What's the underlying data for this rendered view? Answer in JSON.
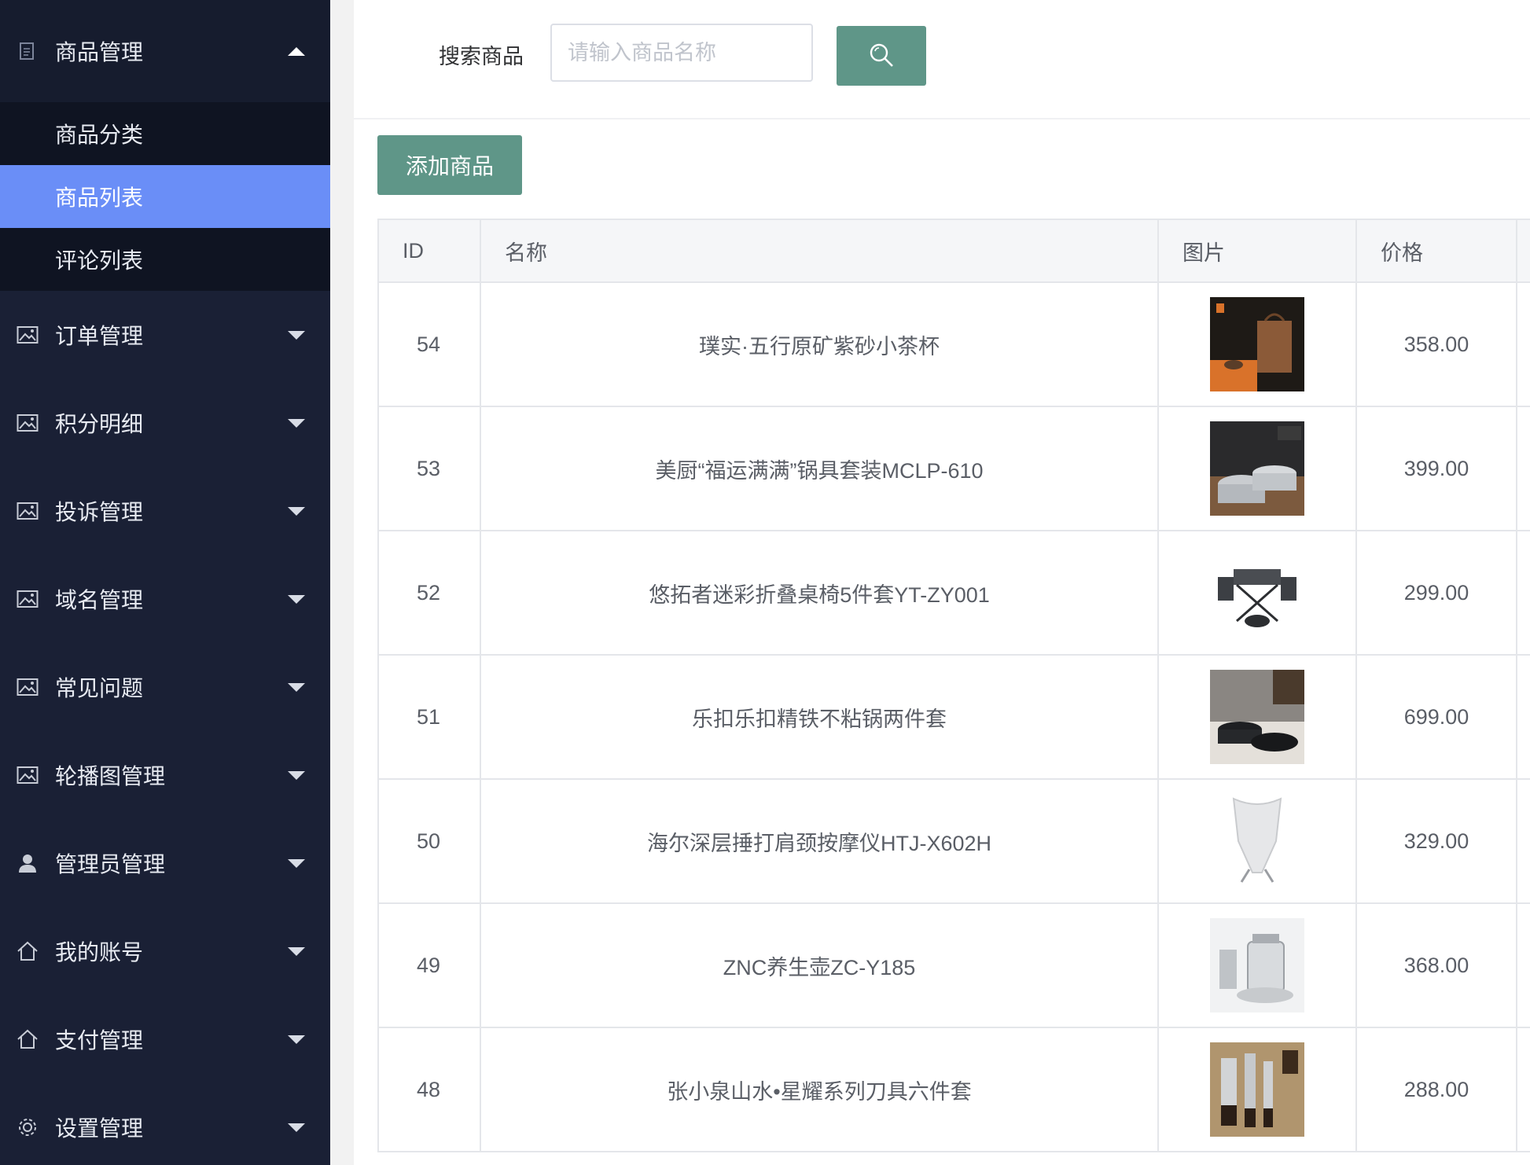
{
  "sidebar": {
    "groups": [
      {
        "label": "商品管理",
        "icon": "document-icon",
        "expanded": true,
        "children": [
          {
            "label": "商品分类",
            "active": false
          },
          {
            "label": "商品列表",
            "active": true
          },
          {
            "label": "评论列表",
            "active": false
          }
        ]
      },
      {
        "label": "订单管理",
        "icon": "image-icon"
      },
      {
        "label": "积分明细",
        "icon": "image-icon"
      },
      {
        "label": "投诉管理",
        "icon": "image-icon"
      },
      {
        "label": "域名管理",
        "icon": "image-icon"
      },
      {
        "label": "常见问题",
        "icon": "image-icon"
      },
      {
        "label": "轮播图管理",
        "icon": "image-icon"
      },
      {
        "label": "管理员管理",
        "icon": "user-icon"
      },
      {
        "label": "我的账号",
        "icon": "home-icon"
      },
      {
        "label": "支付管理",
        "icon": "home-icon"
      },
      {
        "label": "设置管理",
        "icon": "gear-icon"
      }
    ]
  },
  "search": {
    "label": "搜索商品",
    "placeholder": "请输入商品名称",
    "button_icon": "search-icon"
  },
  "actions": {
    "add_label": "添加商品"
  },
  "table": {
    "headers": {
      "id": "ID",
      "name": "名称",
      "image": "图片",
      "price": "价格"
    },
    "rows": [
      {
        "id": "54",
        "name": "璞实·五行原矿紫砂小茶杯",
        "price": "358.00",
        "image": "tea-cup-gift-box"
      },
      {
        "id": "53",
        "name": "美厨“福运满满”锅具套装MCLP-610",
        "price": "399.00",
        "image": "cookware-set"
      },
      {
        "id": "52",
        "name": "悠拓者迷彩折叠桌椅5件套YT-ZY001",
        "price": "299.00",
        "image": "folding-table-chairs"
      },
      {
        "id": "51",
        "name": "乐扣乐扣精铁不粘锅两件套",
        "price": "699.00",
        "image": "non-stick-pans"
      },
      {
        "id": "50",
        "name": "海尔深层捶打肩颈按摩仪HTJ-X602H",
        "price": "329.00",
        "image": "neck-massager"
      },
      {
        "id": "49",
        "name": "ZNC养生壶ZC-Y185",
        "price": "368.00",
        "image": "health-kettle"
      },
      {
        "id": "48",
        "name": "张小泉山水•星耀系列刀具六件套",
        "price": "288.00",
        "image": "knife-set"
      }
    ]
  },
  "colors": {
    "sidebar_bg": "#1a2035",
    "submenu_bg": "#0f1422",
    "active_item": "#6a8ef7",
    "primary_button": "#5f9688"
  }
}
